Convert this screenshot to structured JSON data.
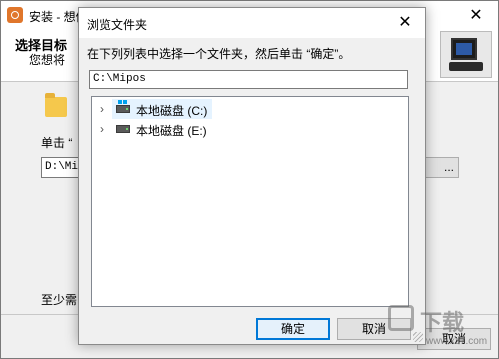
{
  "installer": {
    "title": "安装 - 想做做课",
    "close_glyph": "✕",
    "heading": "选择目标",
    "subheading": "您想将",
    "click_text": "单击 “",
    "path_value": "D:\\Mi",
    "browse_label": "...",
    "space_text": "至少需",
    "cancel_label": "取消"
  },
  "dialog": {
    "title": "浏览文件夹",
    "close_glyph": "✕",
    "instruction": "在下列列表中选择一个文件夹，然后单击 “确定”。",
    "path_value": "C:\\Mipos",
    "tree": [
      {
        "label": "本地磁盘 (C:)",
        "icon": "hard-drive-icon",
        "selected": true
      },
      {
        "label": "本地磁盘 (E:)",
        "icon": "hard-drive-icon",
        "selected": false
      }
    ],
    "chevron_glyph": "›",
    "ok_label": "确定",
    "cancel_label": "取消"
  },
  "watermark": {
    "text": "下载",
    "url": "www.xz7.com"
  },
  "colors": {
    "focus_border": "#0078d7",
    "selection_bg": "#e5f3ff",
    "window_bg": "#f0f0f0"
  }
}
